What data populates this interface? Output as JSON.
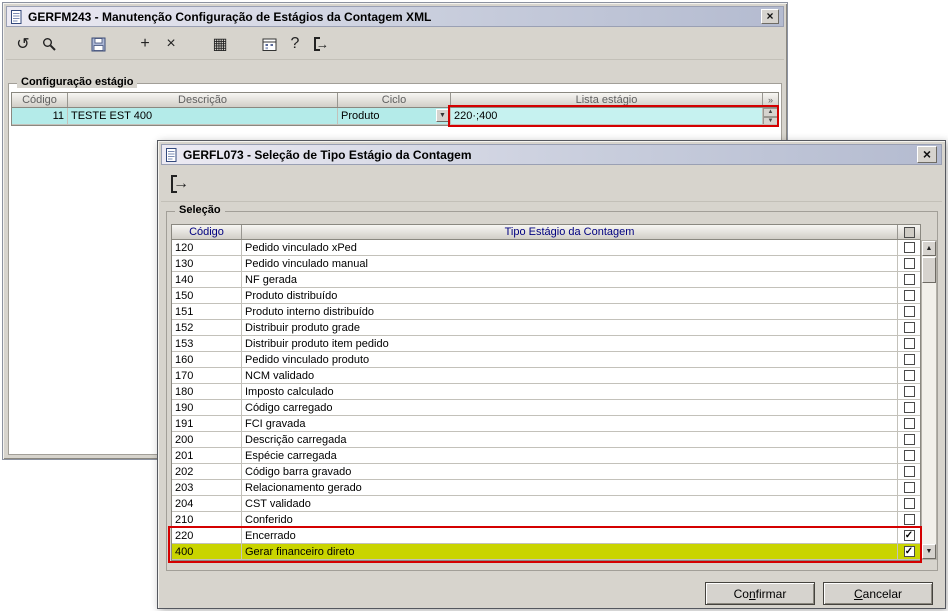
{
  "icons": {
    "close": "×",
    "undo": "↺",
    "plus": "+",
    "delete": "×",
    "grid": "▦",
    "help": "?",
    "arrow": "→",
    "dropdown": "▼",
    "up": "▲",
    "down": "▼",
    "check": "✓",
    "more": "»"
  },
  "bg_window": {
    "title": "GERFM243 - Manutenção Configuração de Estágios da Contagem XML",
    "group_label": "Configuração estágio",
    "table": {
      "headers": {
        "codigo": "Código",
        "descricao": "Descrição",
        "ciclo": "Ciclo",
        "lista": "Lista estágio"
      },
      "row": {
        "codigo": "11",
        "descricao": "TESTE EST 400",
        "ciclo": "Produto",
        "lista": "220·;400"
      }
    }
  },
  "dialog": {
    "title": "GERFL073 - Seleção de Tipo Estágio da Contagem",
    "group_label": "Seleção",
    "table": {
      "headers": {
        "codigo": "Código",
        "tipo": "Tipo Estágio da Contagem"
      },
      "rows": [
        {
          "codigo": "120",
          "tipo": "Pedido vinculado xPed",
          "checked": false
        },
        {
          "codigo": "130",
          "tipo": "Pedido vinculado manual",
          "checked": false
        },
        {
          "codigo": "140",
          "tipo": "NF gerada",
          "checked": false
        },
        {
          "codigo": "150",
          "tipo": "Produto distribuído",
          "checked": false
        },
        {
          "codigo": "151",
          "tipo": "Produto interno distribuído",
          "checked": false
        },
        {
          "codigo": "152",
          "tipo": "Distribuir produto grade",
          "checked": false
        },
        {
          "codigo": "153",
          "tipo": "Distribuir produto item pedido",
          "checked": false
        },
        {
          "codigo": "160",
          "tipo": "Pedido vinculado produto",
          "checked": false
        },
        {
          "codigo": "170",
          "tipo": "NCM validado",
          "checked": false
        },
        {
          "codigo": "180",
          "tipo": "Imposto calculado",
          "checked": false
        },
        {
          "codigo": "190",
          "tipo": "Código carregado",
          "checked": false
        },
        {
          "codigo": "191",
          "tipo": "FCI gravada",
          "checked": false
        },
        {
          "codigo": "200",
          "tipo": "Descrição carregada",
          "checked": false
        },
        {
          "codigo": "201",
          "tipo": "Espécie carregada",
          "checked": false
        },
        {
          "codigo": "202",
          "tipo": "Código barra gravado",
          "checked": false
        },
        {
          "codigo": "203",
          "tipo": "Relacionamento gerado",
          "checked": false
        },
        {
          "codigo": "204",
          "tipo": "CST validado",
          "checked": false
        },
        {
          "codigo": "210",
          "tipo": "Conferido",
          "checked": false
        },
        {
          "codigo": "220",
          "tipo": "Encerrado",
          "checked": true
        },
        {
          "codigo": "400",
          "tipo": "Gerar financeiro direto",
          "checked": true,
          "highlight": true
        }
      ]
    },
    "buttons": {
      "confirm": {
        "pre": "Co",
        "accel": "n",
        "post": "firmar"
      },
      "cancel": {
        "pre": "",
        "accel": "C",
        "post": "ancelar"
      }
    }
  },
  "colors": {
    "selection_cyan": "#b4ebe9",
    "highlight_yellow": "#c9d400",
    "highlight_red": "#d40000",
    "header_navy": "#000080",
    "window_gray": "#d7d4cd"
  }
}
